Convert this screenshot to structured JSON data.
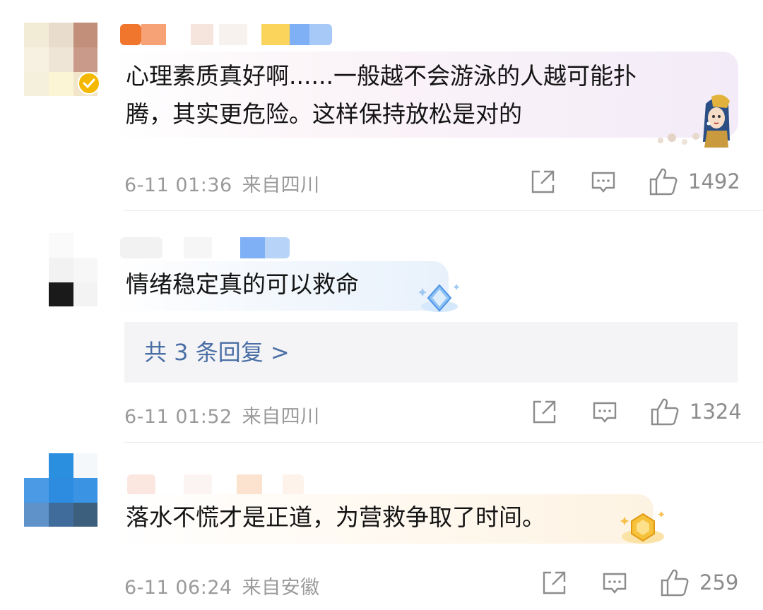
{
  "comments": [
    {
      "text_line1": "心理素质真好啊......一般越不会游泳的人越可能扑",
      "text_line2": "腾，其实更危险。这样保持放松是对的",
      "date": "6-11 01:36",
      "source": "来自四川",
      "likes": "1492"
    },
    {
      "text_line1": "情绪稳定真的可以救命",
      "replies": "共 3 条回复 >",
      "date": "6-11 01:52",
      "source": "来自四川",
      "likes": "1324"
    },
    {
      "text_line1": "落水不慌才是正道，为营救争取了时间。",
      "date": "6-11 06:24",
      "source": "来自安徽",
      "likes": "259"
    }
  ],
  "icons": {
    "repost": "share-icon",
    "reply": "comment-icon",
    "like": "thumbs-up-icon"
  },
  "colors": {
    "link": "#4a6fa5",
    "verified": "#f5b800",
    "meta_text": "#9a9a9a"
  }
}
